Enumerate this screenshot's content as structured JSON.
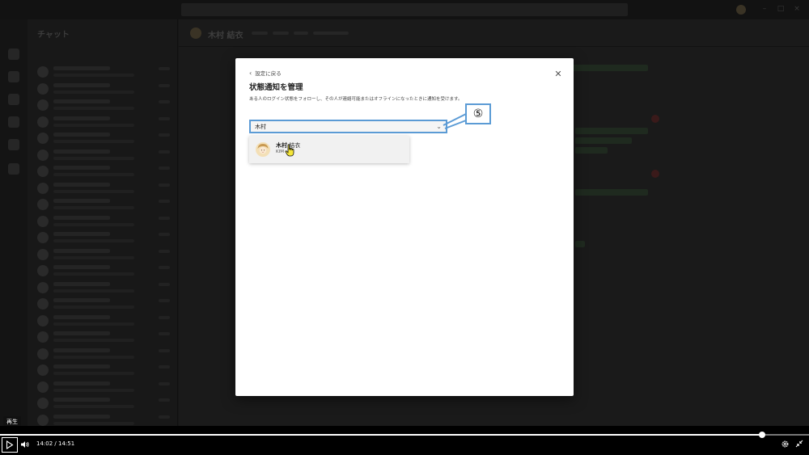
{
  "background": {
    "chat_list_title": "チャット",
    "conversation_name": "木村 結衣"
  },
  "dialog": {
    "back_label": "設定に戻る",
    "title": "状態通知を管理",
    "description": "ある人のログイン状態をフォローし、その人が連絡可能またはオフラインになったときに通知を受けます。",
    "search": {
      "value": "木村",
      "placeholder": ""
    },
    "suggestion": {
      "name_bold": "木村",
      "name_rest": " 結衣",
      "subtitle": "KIM"
    }
  },
  "annotation": {
    "step_label": "⑤",
    "color": "#5b9bd5"
  },
  "player": {
    "tooltip": "再生",
    "current_time": "14:02",
    "separator": " / ",
    "total_time": "14:51",
    "progress": 0.942
  },
  "icons": {
    "back": "chevron-left-icon",
    "close": "close-icon",
    "dropdown": "chevron-down-icon",
    "play": "play-icon",
    "volume": "volume-icon",
    "settings": "gear-icon",
    "shrink": "shrink-icon",
    "cursor": "hand-cursor-icon"
  }
}
